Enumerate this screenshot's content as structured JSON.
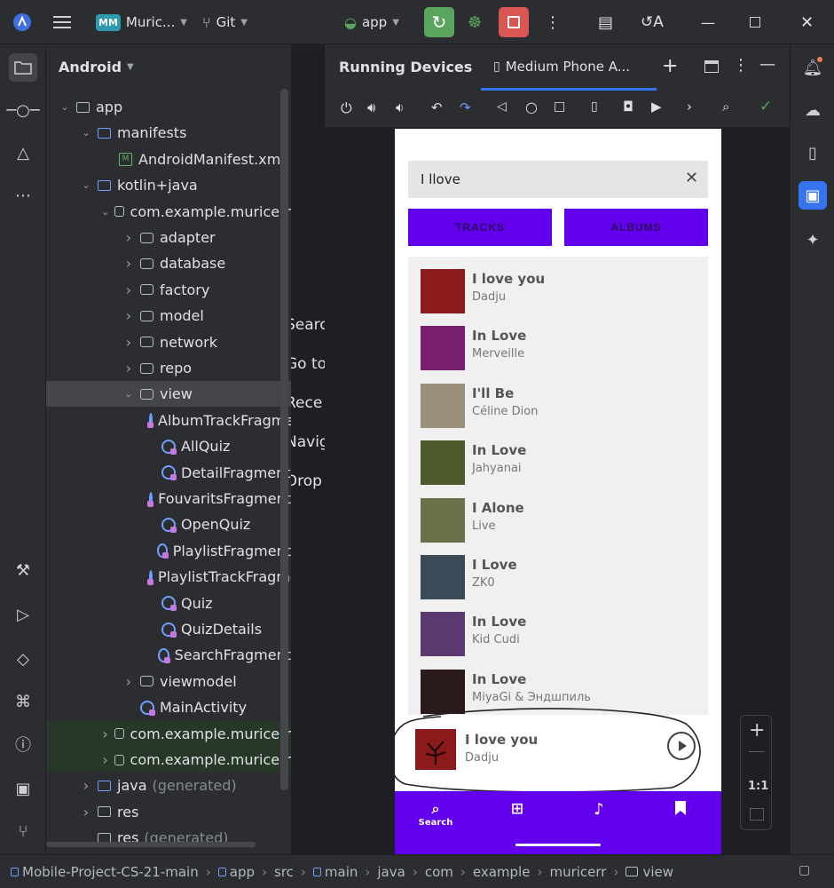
{
  "titlebar": {
    "project_badge": "MM",
    "project_name": "Muric...",
    "vcs_label": "Git",
    "run_config": "app"
  },
  "project_panel": {
    "view_selector": "Android",
    "tree": [
      {
        "label": "app",
        "kind": "module"
      },
      {
        "label": "manifests",
        "kind": "folder"
      },
      {
        "label": "AndroidManifest.xml",
        "kind": "manifest"
      },
      {
        "label": "kotlin+java",
        "kind": "folder"
      },
      {
        "label": "com.example.muricerr",
        "kind": "package"
      },
      {
        "label": "adapter",
        "kind": "package"
      },
      {
        "label": "database",
        "kind": "package"
      },
      {
        "label": "factory",
        "kind": "package"
      },
      {
        "label": "model",
        "kind": "package"
      },
      {
        "label": "network",
        "kind": "package"
      },
      {
        "label": "repo",
        "kind": "package"
      },
      {
        "label": "view",
        "kind": "package"
      },
      {
        "label": "AlbumTrackFragment",
        "kind": "class"
      },
      {
        "label": "AllQuiz",
        "kind": "class"
      },
      {
        "label": "DetailFragment",
        "kind": "class"
      },
      {
        "label": "FouvaritsFragment",
        "kind": "class"
      },
      {
        "label": "OpenQuiz",
        "kind": "class"
      },
      {
        "label": "PlaylistFragment",
        "kind": "class"
      },
      {
        "label": "PlaylistTrackFragment",
        "kind": "class"
      },
      {
        "label": "Quiz",
        "kind": "class"
      },
      {
        "label": "QuizDetails",
        "kind": "class"
      },
      {
        "label": "SearchFragment",
        "kind": "class"
      },
      {
        "label": "viewmodel",
        "kind": "package"
      },
      {
        "label": "MainActivity",
        "kind": "class"
      },
      {
        "label": "com.example.muricerr",
        "kind": "package"
      },
      {
        "label": "com.example.muricerr",
        "kind": "package"
      },
      {
        "label": "java",
        "suffix": "(generated)",
        "kind": "folder"
      },
      {
        "label": "res",
        "kind": "res"
      },
      {
        "label": "res",
        "suffix": "(generated)",
        "kind": "res"
      }
    ]
  },
  "gutter_fragments": [
    "Searc",
    "Go to",
    "Rece",
    "Navig",
    "Drop"
  ],
  "running_devices": {
    "tool_title": "Running Devices",
    "device_tab": "Medium Phone A..."
  },
  "app": {
    "search_query": "I llove",
    "tab_tracks": "TRACKS",
    "tab_albums": "ALBUMS",
    "tracks": [
      {
        "title": "I love you",
        "artist": "Dadju",
        "color": "#8b1a1a"
      },
      {
        "title": "In Love",
        "artist": "Merveille",
        "color": "#7a1f6e"
      },
      {
        "title": "I'll Be",
        "artist": "Céline Dion",
        "color": "#9a8f7a"
      },
      {
        "title": "In Love",
        "artist": "Jahyanai",
        "color": "#4d5a2c"
      },
      {
        "title": "I Alone",
        "artist": "Live",
        "color": "#6a7048"
      },
      {
        "title": "I Love",
        "artist": "ZK0",
        "color": "#3a4a56"
      },
      {
        "title": "In Love",
        "artist": "Kid Cudi",
        "color": "#5a3a70"
      },
      {
        "title": "In Love",
        "artist": "MiyaGi & Эндшпиль",
        "color": "#2a1a1a"
      }
    ],
    "now_playing": {
      "title": "I love you",
      "artist": "Dadju"
    },
    "nav": {
      "search_label": "Search"
    }
  },
  "zoom": {
    "ratio_label": "1:1"
  },
  "breadcrumb": [
    "Mobile-Project-CS-21-main",
    "app",
    "src",
    "main",
    "java",
    "com",
    "example",
    "muricerr",
    "view"
  ],
  "colors": {
    "accent": "#6200ee",
    "ide_bg": "#2b2d30",
    "run_green": "#5aa55e",
    "stop_red": "#d95652"
  }
}
